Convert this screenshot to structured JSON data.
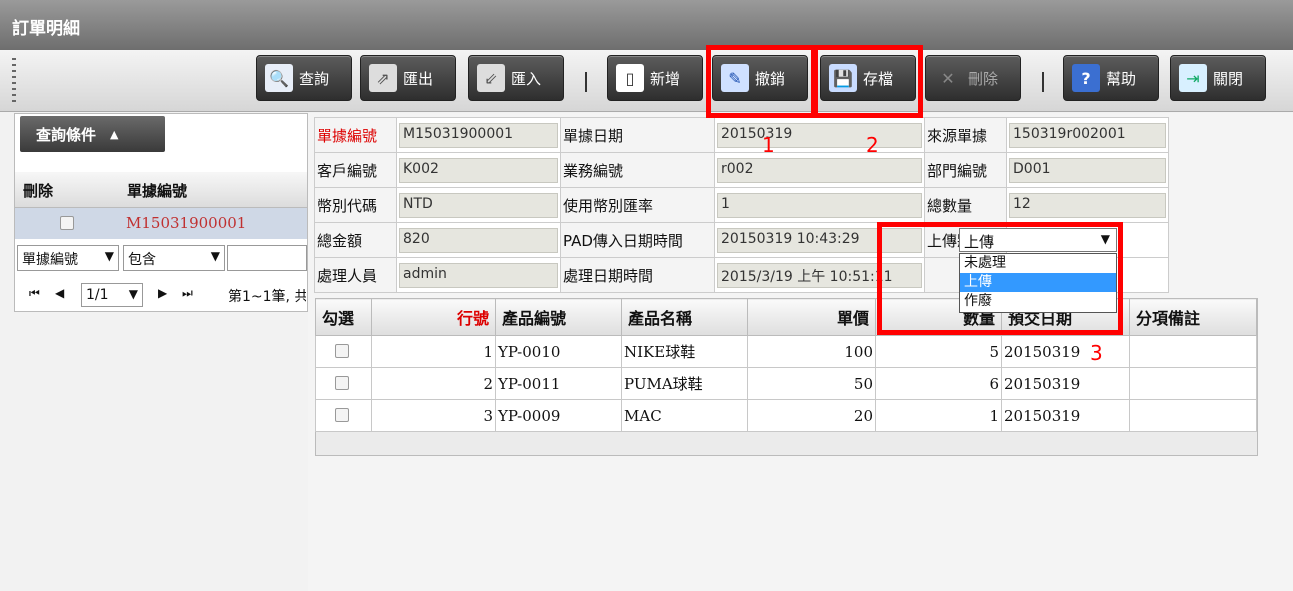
{
  "window": {
    "title": "訂單明細"
  },
  "toolbar": {
    "buttons": [
      {
        "label": "查詢",
        "icon": "magnifier-icon"
      },
      {
        "label": "匯出",
        "icon": "export-icon"
      },
      {
        "label": "匯入",
        "icon": "import-icon"
      },
      {
        "label": "新增",
        "icon": "new-document-icon"
      },
      {
        "label": "撤銷",
        "icon": "edit-undo-icon"
      },
      {
        "label": "存檔",
        "icon": "floppy-save-icon"
      },
      {
        "label": "刪除",
        "icon": "delete-x-icon"
      },
      {
        "label": "幫助",
        "icon": "help-icon"
      },
      {
        "label": "關閉",
        "icon": "exit-door-icon"
      }
    ]
  },
  "annotations": {
    "n1": "1",
    "n2": "2",
    "n3": "3",
    "color": "#ff0000"
  },
  "left_panel": {
    "query_tab": "查詢條件",
    "columns": {
      "delete": "刪除",
      "doc_no": "單據編號"
    },
    "row": {
      "doc_no": "M15031900001"
    },
    "filter": {
      "field": "單據編號",
      "operator": "包含",
      "value": ""
    },
    "pager": {
      "page": "1/1",
      "summary": "第1~1筆, 共"
    }
  },
  "form": {
    "doc_no_label": "單據編號",
    "doc_no": "M15031900001",
    "doc_date_label": "單據日期",
    "doc_date": "20150319",
    "source_label": "來源單據",
    "source": "150319r002001",
    "customer_label": "客戶編號",
    "customer": "K002",
    "sales_label": "業務編號",
    "sales": "r002",
    "dept_label": "部門編號",
    "dept": "D001",
    "currency_label": "幣別代碼",
    "currency": "NTD",
    "rate_label": "使用幣別匯率",
    "rate": "1",
    "total_qty_label": "總數量",
    "total_qty": "12",
    "total_amt_label": "總金額",
    "total_amt": "820",
    "pad_time_label": "PAD傳入日期時間",
    "pad_time": "20150319 10:43:29",
    "upload_label": "上傳狀態",
    "upload_value": "上傳",
    "upload_options": [
      "未處理",
      "上傳",
      "作廢"
    ],
    "handler_label": "處理人員",
    "handler": "admin",
    "process_time_label": "處理日期時間",
    "process_time": "2015/3/19 上午 10:51:11"
  },
  "detail": {
    "headers": [
      "勾選",
      "行號",
      "產品編號",
      "產品名稱",
      "單價",
      "數量",
      "預交日期",
      "分項備註"
    ],
    "rows": [
      {
        "line": "1",
        "code": "YP-0010",
        "name": "NIKE球鞋",
        "price": "100",
        "qty": "5",
        "date": "20150319",
        "note": ""
      },
      {
        "line": "2",
        "code": "YP-0011",
        "name": "PUMA球鞋",
        "price": "50",
        "qty": "6",
        "date": "20150319",
        "note": ""
      },
      {
        "line": "3",
        "code": "YP-0009",
        "name": "MAC",
        "price": "20",
        "qty": "1",
        "date": "20150319",
        "note": ""
      }
    ]
  }
}
